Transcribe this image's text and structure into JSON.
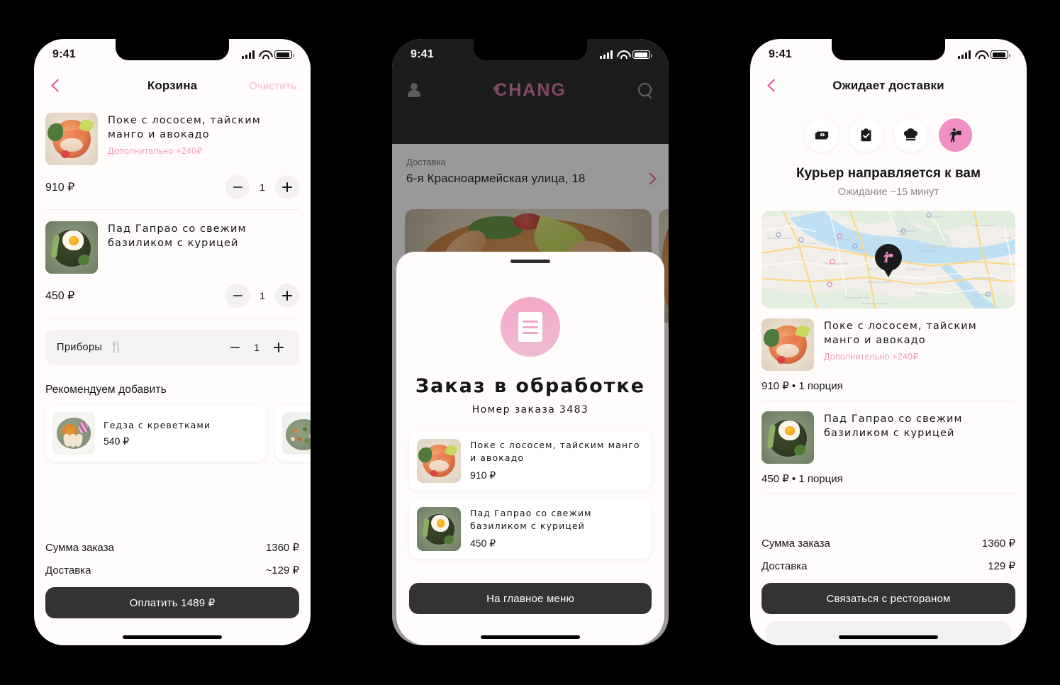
{
  "status_bar": {
    "time": "9:41"
  },
  "brand": {
    "accent_pink": "#E8519B",
    "soft_pink": "#F49DC4",
    "logo_text": "CHANG",
    "dark": "#333334"
  },
  "cart_screen": {
    "nav": {
      "title": "Корзина",
      "action": "Очистить",
      "back_icon": "chevron-left-icon"
    },
    "items": [
      {
        "name": "Поке с лососем, тайским манго и авокадо",
        "extra": "Дополнительно +240₽",
        "price": "910 ₽",
        "qty": "1"
      },
      {
        "name": "Пад Гапрао со свежим базиликом с курицей",
        "extra": "",
        "price": "450 ₽",
        "qty": "1"
      }
    ],
    "cutlery": {
      "label": "Приборы",
      "icon": "cutlery-icon",
      "qty": "1"
    },
    "recommend": {
      "title": "Рекомендуем добавить",
      "cards": [
        {
          "name": "Гедза с креветками",
          "price": "540 ₽"
        },
        {
          "name": "",
          "price": ""
        }
      ]
    },
    "summary": [
      {
        "label": "Сумма заказа",
        "value": "1360 ₽"
      },
      {
        "label": "Доставка",
        "value": "~129 ₽"
      }
    ],
    "pay_button": "Оплатить 1489 ₽"
  },
  "order_screen": {
    "header": {
      "logo": "CHANG",
      "profile_icon": "person-icon",
      "search_icon": "search-icon"
    },
    "address": {
      "label": "Доставка",
      "value": "6-я Красноармейская улица, 18",
      "chevron_icon": "chevron-right-icon"
    },
    "modal": {
      "icon": "document-icon",
      "title": "Заказ в обработке",
      "subtitle": "Номер заказа 3483",
      "items": [
        {
          "name": "Поке с лососем, тайским манго и авокадо",
          "price": "910 ₽"
        },
        {
          "name": "Пад Гапрао со свежим базиликом с курицей",
          "price": "450 ₽"
        }
      ],
      "button": "На главное меню"
    }
  },
  "tracking_screen": {
    "nav": {
      "title": "Ожидает доставки",
      "back_icon": "chevron-left-icon"
    },
    "steps": [
      {
        "icon": "cash-icon",
        "active": false
      },
      {
        "icon": "clipboard-check-icon",
        "active": false
      },
      {
        "icon": "chef-hat-icon",
        "active": false
      },
      {
        "icon": "courier-icon",
        "active": true
      }
    ],
    "status_title": "Курьер направляется к вам",
    "status_sub": "Ожидание ~15 минут",
    "map": {
      "pin_icon": "courier-pin-icon"
    },
    "items": [
      {
        "name": "Поке с лососем, тайским манго и авокадо",
        "extra": "Дополнительно +240₽",
        "meta": "910 ₽  •  1 порция"
      },
      {
        "name": "Пад Гапрао со свежим базиликом с курицей",
        "extra": "",
        "meta": "450 ₽  •  1 порция"
      }
    ],
    "summary": [
      {
        "label": "Сумма заказа",
        "value": "1360 ₽"
      },
      {
        "label": "Доставка",
        "value": "129 ₽"
      }
    ],
    "contact_button": "Связаться с рестораном"
  }
}
